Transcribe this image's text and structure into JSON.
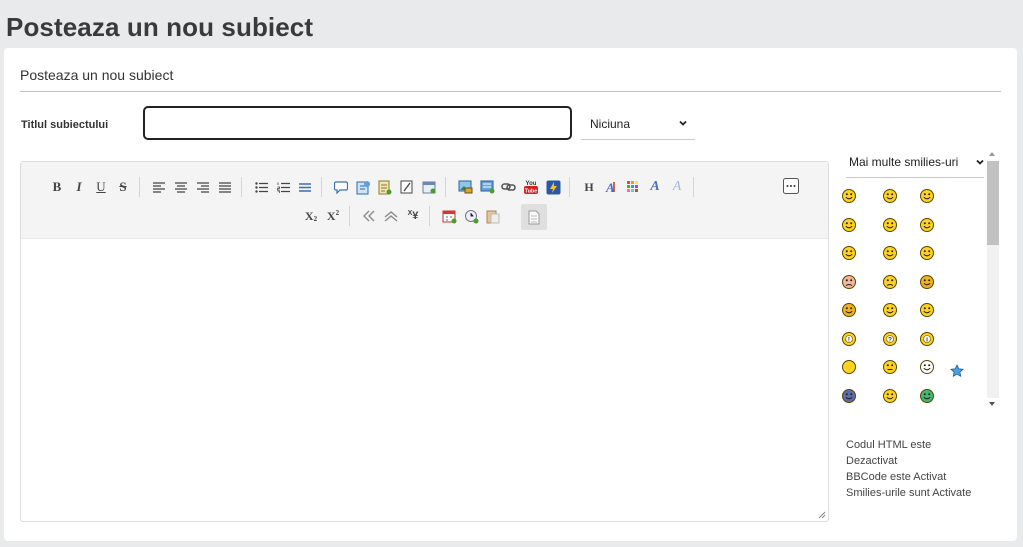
{
  "page": {
    "title": "Posteaza un nou subiect"
  },
  "panel": {
    "heading": "Posteaza un nou subiect"
  },
  "form": {
    "subject_label": "Titlul subiectului",
    "subject_value": "",
    "topic_icon_selected": "Niciuna"
  },
  "toolbar": {
    "buttons": [
      {
        "name": "bold-button",
        "label": "B"
      },
      {
        "name": "italic-button",
        "label": "I"
      },
      {
        "name": "underline-button",
        "label": "U"
      },
      {
        "name": "strikethrough-button",
        "label": "S"
      },
      {
        "name": "align-left-button"
      },
      {
        "name": "align-center-button"
      },
      {
        "name": "align-right-button"
      },
      {
        "name": "justify-button"
      },
      {
        "name": "bullet-list-button"
      },
      {
        "name": "numbered-list-button"
      },
      {
        "name": "horizontal-rule-button"
      },
      {
        "name": "quote-button"
      },
      {
        "name": "code-button"
      },
      {
        "name": "table-button"
      },
      {
        "name": "spoiler-button"
      },
      {
        "name": "hide-button"
      },
      {
        "name": "image-button"
      },
      {
        "name": "image-host-button"
      },
      {
        "name": "link-button"
      },
      {
        "name": "youtube-button",
        "label": "You Tube"
      },
      {
        "name": "flash-button"
      },
      {
        "name": "heading-button",
        "label": "H"
      },
      {
        "name": "font-size-button"
      },
      {
        "name": "color-button"
      },
      {
        "name": "font-button",
        "label": "A"
      },
      {
        "name": "remove-format-button",
        "label": "A"
      },
      {
        "name": "more-button"
      },
      {
        "name": "subscript-button",
        "label": "X"
      },
      {
        "name": "superscript-button",
        "label": "X"
      },
      {
        "name": "ltr-button"
      },
      {
        "name": "rtl-button"
      },
      {
        "name": "character-map-button",
        "label": "¥"
      },
      {
        "name": "date-button"
      },
      {
        "name": "time-button"
      },
      {
        "name": "paste-button"
      },
      {
        "name": "source-button"
      }
    ]
  },
  "smilies": {
    "selector_label": "Mai multe smilies-uri",
    "items": [
      {
        "name": "grin"
      },
      {
        "name": "smile"
      },
      {
        "name": "confused"
      },
      {
        "name": "surprised"
      },
      {
        "name": "glasses"
      },
      {
        "name": "cool"
      },
      {
        "name": "laugh"
      },
      {
        "name": "wink"
      },
      {
        "name": "tongue"
      },
      {
        "name": "sad"
      },
      {
        "name": "sigh"
      },
      {
        "name": "devil"
      },
      {
        "name": "cat-mad"
      },
      {
        "name": "nerd"
      },
      {
        "name": "smirk"
      },
      {
        "name": "exclaim"
      },
      {
        "name": "question"
      },
      {
        "name": "idea"
      },
      {
        "name": "plain"
      },
      {
        "name": "neutral"
      },
      {
        "name": "alien"
      },
      {
        "name": "star"
      },
      {
        "name": "ninja"
      },
      {
        "name": "heart-face"
      },
      {
        "name": "green-face"
      }
    ],
    "colors": {
      "face": "#ffd21e",
      "outline": "#5a4700"
    }
  },
  "status": {
    "html_line1": "Codul HTML este",
    "html_line2": "Dezactivat",
    "bbcode": "BBCode este Activat",
    "smilies": "Smilies-urile sunt Activate"
  },
  "theme": {
    "accent": "#a7c7e7",
    "background": "#e9eaec",
    "panel": "#ffffff"
  }
}
